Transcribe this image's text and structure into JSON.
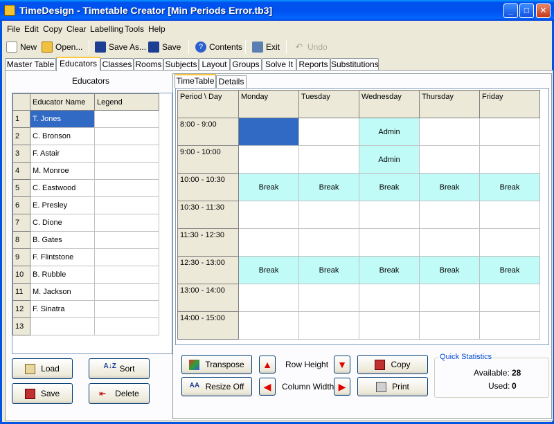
{
  "window": {
    "title": "TimeDesign - Timetable Creator [Min Periods Error.tb3]"
  },
  "menu": [
    "File",
    "Edit",
    "Copy",
    "Clear",
    "Labelling",
    "Tools",
    "Help"
  ],
  "toolbar": {
    "new": "New",
    "open": "Open...",
    "save_as": "Save As...",
    "save": "Save",
    "contents": "Contents",
    "exit": "Exit",
    "undo": "Undo"
  },
  "tabs": [
    "Master Table",
    "Educators",
    "Classes",
    "Rooms",
    "Subjects",
    "Layout",
    "Groups",
    "Solve It",
    "Reports",
    "Substitutions"
  ],
  "educators": {
    "panel_title": "Educators",
    "columns": [
      "Educator Name",
      "Legend"
    ],
    "rows": [
      {
        "n": "1",
        "name": "T. Jones"
      },
      {
        "n": "2",
        "name": "C. Bronson"
      },
      {
        "n": "3",
        "name": "F. Astair"
      },
      {
        "n": "4",
        "name": "M. Monroe"
      },
      {
        "n": "5",
        "name": "C. Eastwood"
      },
      {
        "n": "6",
        "name": "E. Presley"
      },
      {
        "n": "7",
        "name": "C. Dione"
      },
      {
        "n": "8",
        "name": "B. Gates"
      },
      {
        "n": "9",
        "name": "F. Flintstone"
      },
      {
        "n": "10",
        "name": "B. Rubble"
      },
      {
        "n": "11",
        "name": "M. Jackson"
      },
      {
        "n": "12",
        "name": "F. Sinatra"
      },
      {
        "n": "13",
        "name": ""
      }
    ],
    "buttons": {
      "load": "Load",
      "sort": "Sort",
      "save": "Save",
      "delete": "Delete"
    }
  },
  "subtabs": [
    "TimeTable",
    "Details"
  ],
  "timetable": {
    "corner": "Period \\ Day",
    "days": [
      "Monday",
      "Tuesday",
      "Wednesday",
      "Thursday",
      "Friday"
    ],
    "periods": [
      {
        "label": "8:00 - 9:00",
        "cells": [
          "",
          "",
          "Admin",
          "",
          ""
        ]
      },
      {
        "label": "9:00 - 10:00",
        "cells": [
          "",
          "",
          "Admin",
          "",
          ""
        ]
      },
      {
        "label": "10:00 - 10:30",
        "cells": [
          "Break",
          "Break",
          "Break",
          "Break",
          "Break"
        ]
      },
      {
        "label": "10:30 - 11:30",
        "cells": [
          "",
          "",
          "",
          "",
          ""
        ]
      },
      {
        "label": "11:30 - 12:30",
        "cells": [
          "",
          "",
          "",
          "",
          ""
        ]
      },
      {
        "label": "12:30 - 13:00",
        "cells": [
          "Break",
          "Break",
          "Break",
          "Break",
          "Break"
        ]
      },
      {
        "label": "13:00 - 14:00",
        "cells": [
          "",
          "",
          "",
          "",
          ""
        ]
      },
      {
        "label": "14:00 - 15:00",
        "cells": [
          "",
          "",
          "",
          "",
          ""
        ]
      }
    ]
  },
  "controls": {
    "transpose": "Transpose",
    "resize_off": "Resize Off",
    "row_height": "Row Height",
    "column_width": "Column Width",
    "copy": "Copy",
    "print": "Print"
  },
  "quick_stats": {
    "title": "Quick Statistics",
    "available_label": "Available:",
    "available": "28",
    "used_label": "Used:",
    "used": "0"
  }
}
